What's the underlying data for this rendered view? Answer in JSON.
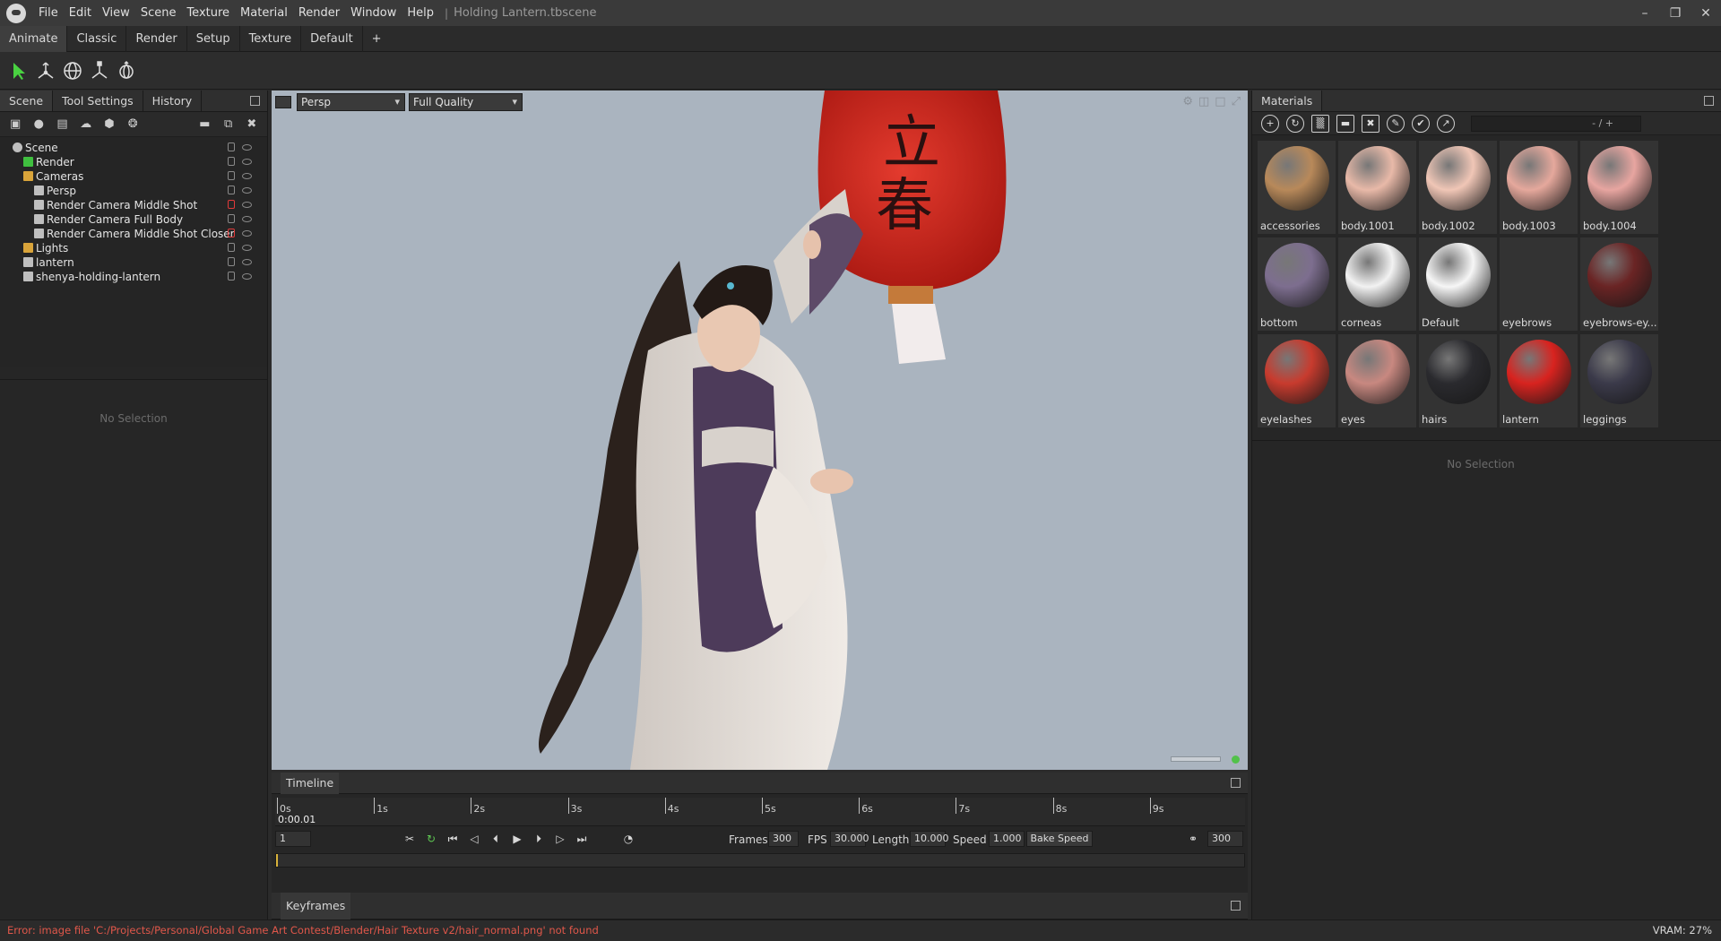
{
  "app": {
    "menu": [
      "File",
      "Edit",
      "View",
      "Scene",
      "Texture",
      "Material",
      "Render",
      "Window",
      "Help"
    ],
    "document_title": "Holding Lantern.tbscene",
    "workspace_tabs": [
      "Animate",
      "Classic",
      "Render",
      "Setup",
      "Texture",
      "Default",
      "+"
    ],
    "active_workspace": "Animate"
  },
  "left_panel": {
    "tabs": [
      "Scene",
      "Tool Settings",
      "History"
    ],
    "active_tab": "Scene",
    "tree": [
      {
        "label": "Scene",
        "depth": 0,
        "type": "scene-icon",
        "locked_red": false
      },
      {
        "label": "Render",
        "depth": 1,
        "type": "gear-icon",
        "locked_red": false
      },
      {
        "label": "Cameras",
        "depth": 1,
        "type": "folder-icon",
        "locked_red": false
      },
      {
        "label": "Persp",
        "depth": 2,
        "type": "camera-icon",
        "locked_red": false
      },
      {
        "label": "Render Camera Middle Shot",
        "depth": 2,
        "type": "camera-icon",
        "locked_red": true
      },
      {
        "label": "Render Camera Full Body",
        "depth": 2,
        "type": "camera-icon",
        "locked_red": false
      },
      {
        "label": "Render Camera Middle Shot Closer",
        "depth": 2,
        "type": "camera-icon",
        "locked_red": true
      },
      {
        "label": "Lights",
        "depth": 1,
        "type": "folder-icon",
        "locked_red": false
      },
      {
        "label": "lantern",
        "depth": 1,
        "type": "mesh-icon",
        "locked_red": false
      },
      {
        "label": "shenya-holding-lantern",
        "depth": 1,
        "type": "mesh-icon",
        "locked_red": false
      }
    ],
    "properties_empty": "No Selection"
  },
  "viewport": {
    "camera_select": "Persp",
    "quality_select": "Full Quality",
    "lantern_text": "立春"
  },
  "materials": {
    "title": "Materials",
    "search_text": "- / +",
    "items": [
      {
        "name": "accessories",
        "color": "#b8895a"
      },
      {
        "name": "body.1001",
        "color": "#e8b9a8"
      },
      {
        "name": "body.1002",
        "color": "#f0c6b6"
      },
      {
        "name": "body.1003",
        "color": "#e5a89c"
      },
      {
        "name": "body.1004",
        "color": "#e7a5a0"
      },
      {
        "name": "bottom",
        "color": "#7d6e8f"
      },
      {
        "name": "corneas",
        "color": "#f2f2f2"
      },
      {
        "name": "Default",
        "color": "#f6f6f6"
      },
      {
        "name": "eyebrows",
        "color": "#2a2424"
      },
      {
        "name": "eyebrows-ey...",
        "color": "#6a2424"
      },
      {
        "name": "eyelashes",
        "color": "#c83b2e"
      },
      {
        "name": "eyes",
        "color": "#c88880"
      },
      {
        "name": "hairs",
        "color": "#2a2a2e"
      },
      {
        "name": "lantern",
        "color": "#d8231f"
      },
      {
        "name": "leggings",
        "color": "#3b3a4a"
      }
    ],
    "properties_empty": "No Selection"
  },
  "timeline": {
    "title": "Timeline",
    "time_readout": "0:00.01",
    "ticks": [
      "0s",
      "1s",
      "2s",
      "3s",
      "4s",
      "5s",
      "6s",
      "7s",
      "8s",
      "9s"
    ],
    "current_frame": "1",
    "frames_label": "Frames",
    "frames_value": "300",
    "fps_label": "FPS",
    "fps_value": "30.000",
    "length_label": "Length",
    "length_value": "10.000",
    "speed_label": "Speed",
    "speed_value": "1.000",
    "bake_label": "Bake Speed",
    "end_frame": "300"
  },
  "keyframes": {
    "title": "Keyframes"
  },
  "status": {
    "error": "Error: image file 'C:/Projects/Personal/Global Game Art Contest/Blender/Hair Texture v2/hair_normal.png' not found",
    "vram": "VRAM: 27%"
  }
}
